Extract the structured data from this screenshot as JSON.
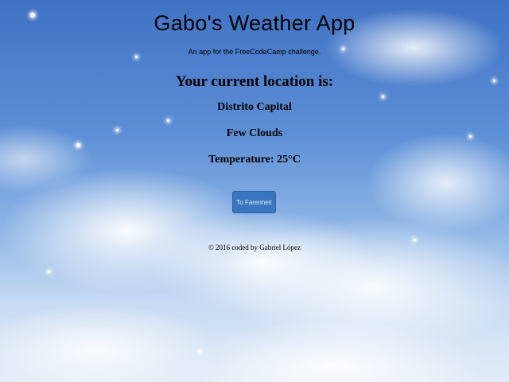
{
  "header": {
    "title": "Gabo's Weather App",
    "subtitle": "An app for the FreeCodeCamp challenge."
  },
  "weather": {
    "location_heading": "Your current location is:",
    "location": "Distrito Capital",
    "conditions": "Few Clouds",
    "temperature": "Temperature: 25°C"
  },
  "controls": {
    "unit_toggle_label": "To Farenheit"
  },
  "footer": {
    "credit": "© 2016 coded by Gabriel López"
  },
  "colors": {
    "button": "#3a76c0",
    "sky": "#5d8fd6"
  }
}
